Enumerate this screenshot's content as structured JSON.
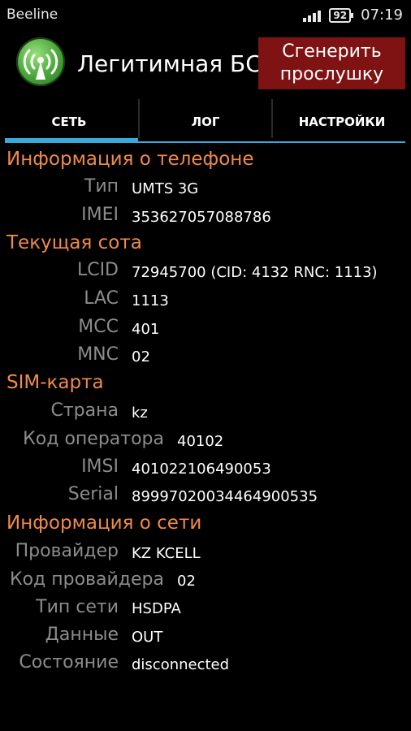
{
  "status_bar": {
    "carrier": "Beeline",
    "battery": "92",
    "time": "07:19"
  },
  "action_bar": {
    "title": "Легитимная БС",
    "button_line1": "Сгенерить",
    "button_line2": "прослушку",
    "icon": "antenna-icon"
  },
  "tabs": [
    {
      "label": "СЕТЬ",
      "selected": true
    },
    {
      "label": "ЛОГ",
      "selected": false
    },
    {
      "label": "НАСТРОЙКИ",
      "selected": false
    }
  ],
  "colors": {
    "accent": "#3aa8d8",
    "section": "#f08a4b",
    "label": "#8c8c8c",
    "button": "#7f1212"
  },
  "phone_info": {
    "title": "Информация о телефоне",
    "rows": [
      {
        "label": "Тип",
        "value": "UMTS 3G"
      },
      {
        "label": "IMEI",
        "value": "353627057088786"
      }
    ]
  },
  "current_cell": {
    "title": "Текущая сота",
    "rows": [
      {
        "label": "LCID",
        "value": "72945700 (CID: 4132 RNC: 1113)"
      },
      {
        "label": "LAC",
        "value": "1113"
      },
      {
        "label": "MCC",
        "value": "401"
      },
      {
        "label": "MNC",
        "value": "02"
      }
    ]
  },
  "sim_card": {
    "title": "SIM-карта",
    "rows": [
      {
        "label": "Страна",
        "value": "kz"
      },
      {
        "label": "Код оператора",
        "value": "40102"
      },
      {
        "label": "IMSI",
        "value": "401022106490053"
      },
      {
        "label": "Serial",
        "value": "89997020034464900535"
      }
    ]
  },
  "network_info": {
    "title": "Информация о сети",
    "rows": [
      {
        "label": "Провайдер",
        "value": "KZ KCELL"
      },
      {
        "label": "Код провайдера",
        "value": "02"
      },
      {
        "label": "Тип сети",
        "value": "HSDPA"
      },
      {
        "label": "Данные",
        "value": "OUT"
      },
      {
        "label": "Состояние",
        "value": "disconnected"
      }
    ]
  }
}
